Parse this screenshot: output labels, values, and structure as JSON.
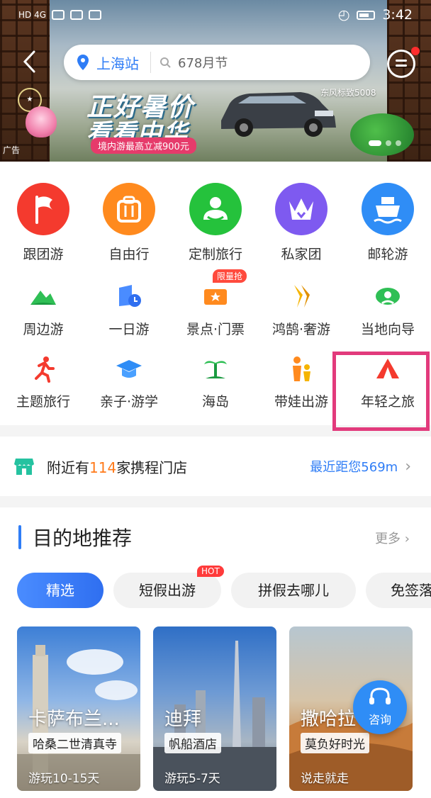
{
  "status_bar": {
    "left_label": "HD 4G",
    "time": "3:42"
  },
  "header": {
    "city": "上海站",
    "search_placeholder": "678月节"
  },
  "banner": {
    "line1": "正好暑价",
    "line2": "看看中华",
    "badge": "境内游最高立减900元",
    "brand": "东风标致5008",
    "ad_label": "广告"
  },
  "categories": {
    "big": [
      {
        "label": "跟团游",
        "color": "#f43a2e",
        "icon": "flag-icon"
      },
      {
        "label": "自由行",
        "color": "#ff8a1e",
        "icon": "suitcase-icon"
      },
      {
        "label": "定制旅行",
        "color": "#25c23c",
        "icon": "person-icon"
      },
      {
        "label": "私家团",
        "color": "#7e5af0",
        "icon": "crown-icon"
      },
      {
        "label": "邮轮游",
        "color": "#2f8df6",
        "icon": "ship-icon"
      }
    ],
    "row2": [
      {
        "label": "周边游",
        "icon": "mountain-icon"
      },
      {
        "label": "一日游",
        "icon": "day-trip-icon"
      },
      {
        "label": "景点·门票",
        "icon": "ticket-icon"
      },
      {
        "label": "鸿鹄·奢游",
        "icon": "luxury-icon"
      },
      {
        "label": "当地向导",
        "icon": "guide-icon"
      }
    ],
    "row3": [
      {
        "label": "主题旅行",
        "icon": "runner-icon"
      },
      {
        "label": "亲子·游学",
        "icon": "graduation-cap-icon"
      },
      {
        "label": "海岛",
        "icon": "palm-tree-icon"
      },
      {
        "label": "带娃出游",
        "icon": "family-icon"
      },
      {
        "label": "年轻之旅",
        "icon": "tent-icon"
      }
    ],
    "limited_badge": "限量抢"
  },
  "stores": {
    "prefix": "附近有",
    "count": "114",
    "suffix": "家携程门店",
    "distance": "最近距您569m"
  },
  "destinations": {
    "title": "目的地推荐",
    "more": "更多",
    "tabs": [
      "精选",
      "短假出游",
      "拼假去哪儿",
      "免签落"
    ],
    "hot_badge": "HOT",
    "tiles": [
      {
        "name": "卡萨布兰...",
        "tag": "哈桑二世清真寺",
        "duration": "游玩10-15天"
      },
      {
        "name": "迪拜",
        "tag": "帆船酒店",
        "duration": "游玩5-7天"
      },
      {
        "name": "撒哈拉",
        "tag": "莫负好时光",
        "duration": "说走就走"
      }
    ],
    "consult_label": "咨询"
  },
  "colors": {
    "accent": "#2f7df6",
    "orange": "#ff7a1a",
    "highlight": "#e23a7c"
  }
}
